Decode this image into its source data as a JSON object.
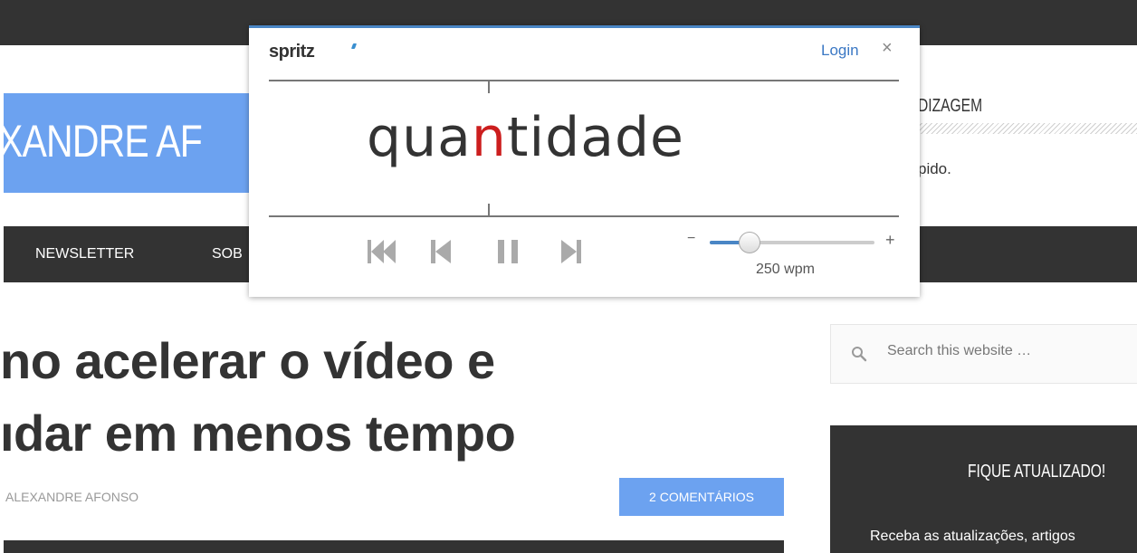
{
  "site": {
    "title": "XANDRE AF",
    "nav": [
      "NEWSLETTER",
      "SOB"
    ]
  },
  "sidebar": {
    "widget_title": "DIZAGEM",
    "widget_text": "pido.",
    "search_placeholder": "Search this website …",
    "newsletter_title": "FIQUE ATUALIZADO!",
    "newsletter_text": "Receba as atualizações, artigos"
  },
  "post": {
    "title_line1": "no acelerar o vídeo e",
    "title_line2": "ıdar em menos tempo",
    "author": "ALEXANDRE AFONSO",
    "comments_label": "2 COMENTÁRIOS"
  },
  "spritz": {
    "logo": "spritz",
    "login_label": "Login",
    "close_label": "×",
    "word_pre": "qua",
    "word_orp": "n",
    "word_post": "tidade",
    "speed_minus": "−",
    "speed_plus": "+",
    "speed_label": "250 wpm",
    "speed_fraction": 0.24,
    "accent_color": "#4a86c5",
    "orp_color": "#cc1e1e",
    "controls": [
      "rewind-icon",
      "previous-icon",
      "pause-icon",
      "next-icon"
    ]
  }
}
